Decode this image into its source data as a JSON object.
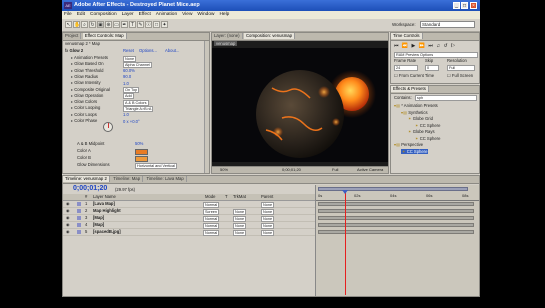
{
  "window": {
    "title": "Adobe After Effects - Destroyed Planet Mice.aep",
    "logo": "AE",
    "minimize": "_",
    "maximize": "□",
    "close": "×"
  },
  "menu": [
    "File",
    "Edit",
    "Composition",
    "Layer",
    "Effect",
    "Animation",
    "View",
    "Window",
    "Help"
  ],
  "toolbar": {
    "workspace_label": "Workspace:",
    "workspace_value": "Standard"
  },
  "project_panel": {
    "tabs": [
      "Project",
      "Effect Controls: Map"
    ],
    "header": "venusmap 2 * Map",
    "effect_name": "Glow 2",
    "effect_links": [
      "Reset",
      "Options...",
      "About..."
    ],
    "properties": [
      {
        "label": "Animation Presets",
        "value": "None"
      },
      {
        "label": "Glow Based On",
        "value": "Alpha Channel"
      },
      {
        "label": "Glow Threshold",
        "value": "60.0%"
      },
      {
        "label": "Glow Radius",
        "value": "90.0"
      },
      {
        "label": "Glow Intensity",
        "value": "1.0"
      },
      {
        "label": "Composite Original",
        "value": "On Top"
      },
      {
        "label": "Glow Operation",
        "value": "Add"
      },
      {
        "label": "Glow Colors",
        "value": "A & B Colors"
      },
      {
        "label": "Color Looping",
        "value": "Triangle A>B>A"
      },
      {
        "label": "Color Loops",
        "value": "1.0"
      },
      {
        "label": "Color Phase",
        "value": "0 x +0.0°"
      }
    ],
    "midpoint": {
      "label": "A & B Midpoint",
      "value": "50%"
    },
    "color_a": "Color A",
    "color_b": "Color B",
    "glow_dimensions": {
      "label": "Glow Dimensions",
      "value": "Horizontal and Vertical"
    }
  },
  "viewer": {
    "tabs": [
      "Layer: (none)",
      "Composition: venusmap"
    ],
    "subtab": "venusmap",
    "controls": {
      "zoom": "50%",
      "time": "0;00;01;20",
      "quality": "Full",
      "camera": "Active Camera"
    }
  },
  "time_controls": {
    "tab": "Time Controls",
    "ram_preview": "RAM Preview Options",
    "frame_rate_label": "Frame Rate",
    "frame_rate": "24",
    "skip_label": "Skip",
    "skip": "0",
    "resolution_label": "Resolution",
    "resolution": "Full",
    "from_current": "From Current Time",
    "full_screen": "Full Screen"
  },
  "effects_presets": {
    "tab": "Effects & Presets",
    "contains_label": "Contains:",
    "contains_value": "sph",
    "tree": [
      {
        "label": "* Animation Presets",
        "depth": 0
      },
      {
        "label": "Synthetics",
        "depth": 1
      },
      {
        "label": "Globe Grid",
        "depth": 2
      },
      {
        "label": "CC Sphere",
        "depth": 3
      },
      {
        "label": "Globe Rays",
        "depth": 2
      },
      {
        "label": "CC Sphere",
        "depth": 3
      },
      {
        "label": "Perspective",
        "depth": 0
      },
      {
        "label": "CC Sphere",
        "depth": 1,
        "selected": true
      }
    ]
  },
  "timeline": {
    "tabs": [
      "Timeline: venusmap 2",
      "Timeline: Map",
      "Timeline: Lava Map"
    ],
    "timecode": "0;00;01;20",
    "fps": "(29.97 fps)",
    "columns": [
      "#",
      "Layer Name",
      "Mode",
      "T",
      "TrkMat",
      "Parent"
    ],
    "layers": [
      {
        "num": "1",
        "name": "[Lava Map]",
        "mode": "Normal",
        "trkmat": "",
        "parent": "None"
      },
      {
        "num": "2",
        "name": "Map Highlight",
        "mode": "Screen",
        "trkmat": "None",
        "parent": "None"
      },
      {
        "num": "3",
        "name": "[Map]",
        "mode": "Normal",
        "trkmat": "None",
        "parent": "None"
      },
      {
        "num": "4",
        "name": "[Map]",
        "mode": "Normal",
        "trkmat": "None",
        "parent": "None"
      },
      {
        "num": "5",
        "name": "[spacedB.jpg]",
        "mode": "Normal",
        "trkmat": "None",
        "parent": "None"
      }
    ],
    "ruler": [
      "0s",
      "02s",
      "04s",
      "06s",
      "08s"
    ]
  }
}
